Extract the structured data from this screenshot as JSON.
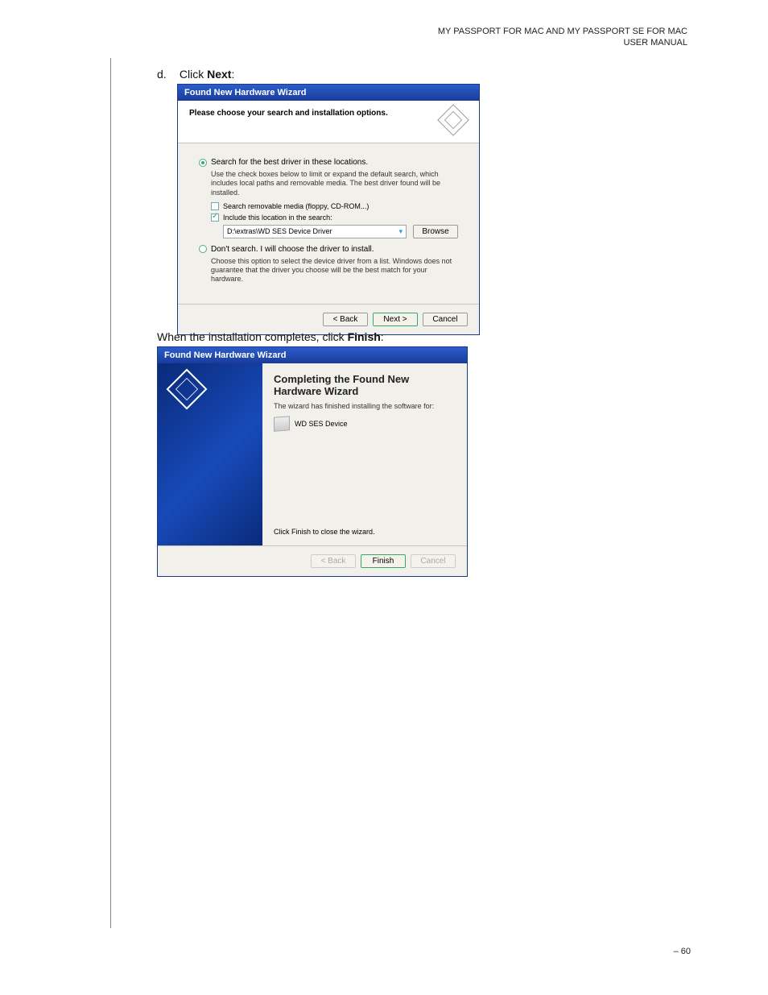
{
  "header": {
    "line1": "MY PASSPORT FOR MAC AND MY PASSPORT SE FOR MAC",
    "line2": "USER MANUAL"
  },
  "step": {
    "marker": "d.",
    "prefix": "Click ",
    "bold": "Next",
    "suffix": ":"
  },
  "dialog1": {
    "title": "Found New Hardware Wizard",
    "subtitle": "Please choose your search and installation options.",
    "radio1": "Search for the best driver in these locations.",
    "help1": "Use the check boxes below to limit or expand the default search, which includes local paths and removable media. The best driver found will be installed.",
    "check1": "Search removable media (floppy, CD-ROM...)",
    "check2": "Include this location in the search:",
    "path": "D:\\extras\\WD SES Device Driver",
    "browse": "Browse",
    "radio2": "Don't search. I will choose the driver to install.",
    "help2": "Choose this option to select the device driver from a list. Windows does not guarantee that the driver you choose will be the best match for your hardware.",
    "back": "< Back",
    "next": "Next >",
    "cancel": "Cancel"
  },
  "instr2": {
    "prefix": "When the installation completes, click ",
    "bold": "Finish",
    "suffix": ":"
  },
  "dialog2": {
    "title": "Found New Hardware Wizard",
    "heading": "Completing the Found New Hardware Wizard",
    "sub": "The wizard has finished installing the software for:",
    "device": "WD SES Device",
    "close": "Click Finish to close the wizard.",
    "back": "< Back",
    "finish": "Finish",
    "cancel": "Cancel"
  },
  "page_number": "– 60"
}
